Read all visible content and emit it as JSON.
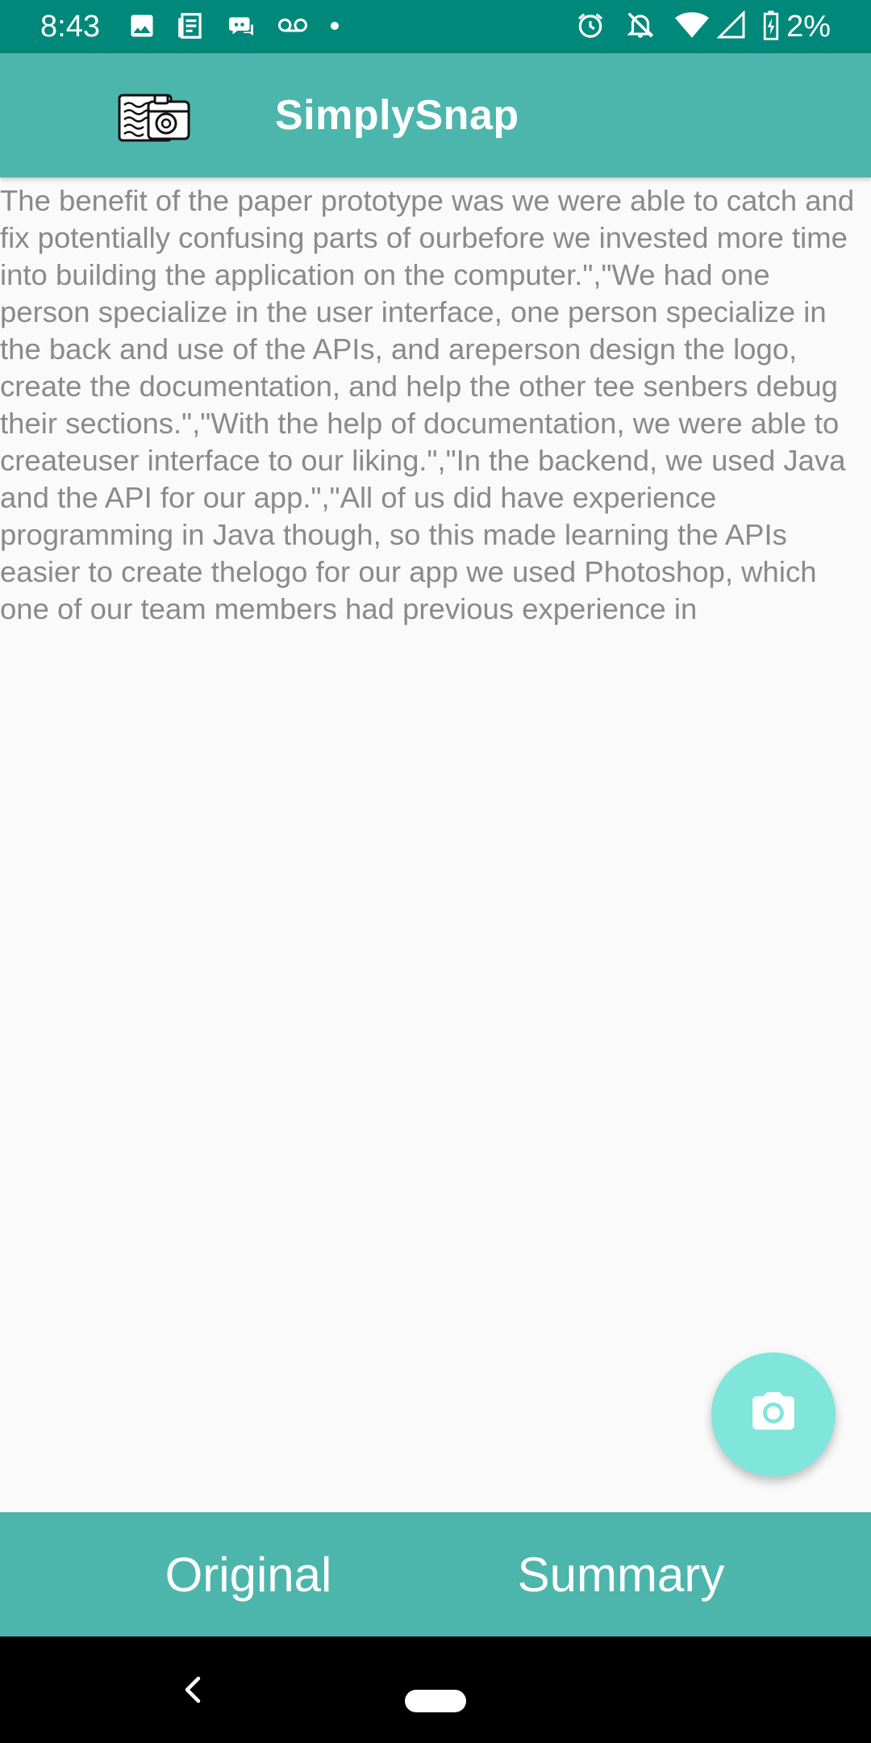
{
  "status_bar": {
    "time": "8:43",
    "left_icons": [
      "image-icon",
      "news-icon",
      "discord-icon",
      "voicemail-icon",
      "dot-icon"
    ],
    "right_icons": [
      "alarm-icon",
      "notifications-off-icon",
      "wifi-icon",
      "signal-icon",
      "battery-charging-icon"
    ],
    "battery": "2%"
  },
  "app_bar": {
    "logo_icon": "camera-document-logo",
    "title": "SimplySnap"
  },
  "content": {
    "text": "The benefit of the paper prototype was we were able to catch and fix potentially confusing parts of ourbefore we invested more time into building the application on the computer.\",\"We had one person specialize in the user interface, one person specialize in the back and use of the APIs, and areperson design the logo, create the documentation, and help the other tee senbers debug their sections.\",\"With the help of documentation, we were able to createuser interface to our liking.\",\"In the backend, we used Java and the API for our app.\",\"All of us did have experience programming in Java though, so this made learning the APIs easier to create thelogo for our app we used Photoshop, which one of our team members had previous experience in"
  },
  "fab": {
    "icon": "camera-icon"
  },
  "bottom_tabs": [
    {
      "label": "Original"
    },
    {
      "label": "Summary"
    }
  ],
  "nav_bar": {
    "back_icon": "back-icon",
    "home_icon": "home-pill-icon"
  },
  "colors": {
    "status_bar": "#00897b",
    "primary": "#4db6ac",
    "fab": "#80e5da",
    "body_text": "#8a8a8a",
    "background": "#fafafa"
  }
}
